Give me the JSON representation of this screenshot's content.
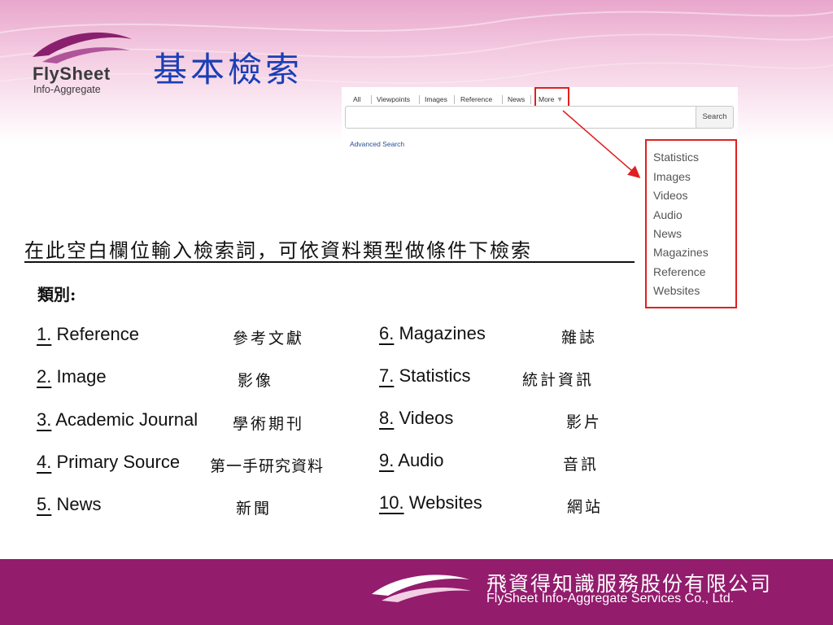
{
  "slide": {
    "title": "基本檢索",
    "logo": {
      "name": "FlySheet",
      "subtitle": "Info-Aggregate"
    },
    "instruction": "在此空白欄位輸入檢索詞，可依資料類型做條件下檢索",
    "category_heading": "類別:"
  },
  "search_widget": {
    "tabs": [
      "All",
      "Viewpoints",
      "Images",
      "Reference",
      "News",
      "More"
    ],
    "search_button": "Search",
    "advanced_search": "Advanced Search",
    "more_dropdown": [
      "Statistics",
      "Images",
      "Videos",
      "Audio",
      "News",
      "Magazines",
      "Reference",
      "Websites"
    ]
  },
  "categories": [
    {
      "num": "1.",
      "en": "Reference",
      "zh": "參考文獻"
    },
    {
      "num": "2.",
      "en": "Image",
      "zh": "影像"
    },
    {
      "num": "3.",
      "en": "Academic Journal",
      "zh": "學術期刊"
    },
    {
      "num": "4.",
      "en": "Primary Source",
      "zh": "第一手研究資料"
    },
    {
      "num": "5.",
      "en": "News",
      "zh": "新聞"
    },
    {
      "num": "6.",
      "en": "Magazines",
      "zh": "雜誌"
    },
    {
      "num": "7.",
      "en": "Statistics",
      "zh": "統計資訊"
    },
    {
      "num": "8.",
      "en": "Videos",
      "zh": "影片"
    },
    {
      "num": "9.",
      "en": "Audio",
      "zh": "音訊"
    },
    {
      "num": "10.",
      "en": "Websites",
      "zh": "網站"
    }
  ],
  "footer": {
    "company_zh": "飛資得知識服務股份有限公司",
    "company_en": "FlySheet Info-Aggregate Services Co., Ltd."
  },
  "colors": {
    "brand": "#931c6d",
    "title": "#1a3fb5",
    "highlight": "#e02020"
  }
}
